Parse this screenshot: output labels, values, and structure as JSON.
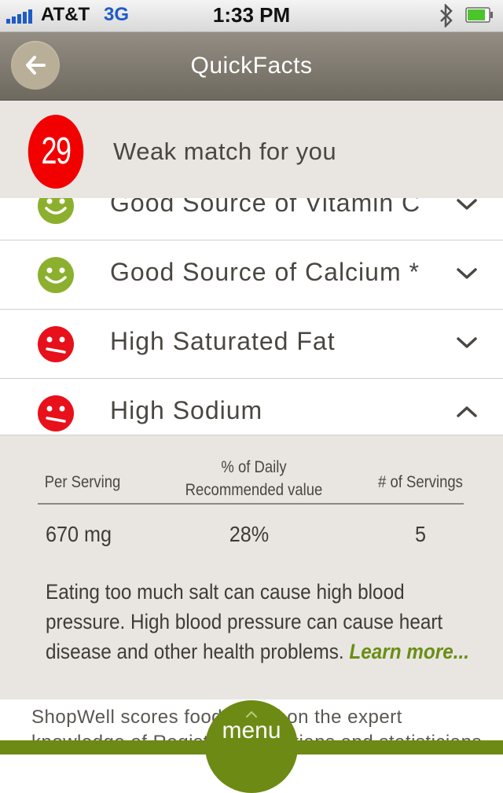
{
  "status_bar": {
    "carrier": "AT&T",
    "network": "3G",
    "time": "1:33 PM"
  },
  "header": {
    "title": "QuickFacts",
    "back_icon": "back-arrow-icon"
  },
  "score": {
    "value": "29",
    "text": "Weak match for you",
    "color": "#f20000"
  },
  "facts": [
    {
      "label": "Good Source of Vitamin C",
      "status": "good",
      "expanded": false
    },
    {
      "label": "Good Source of Calcium *",
      "status": "good",
      "expanded": false
    },
    {
      "label": "High Saturated Fat",
      "status": "bad",
      "expanded": false
    },
    {
      "label": "High Sodium",
      "status": "bad",
      "expanded": true
    }
  ],
  "detail": {
    "headers": {
      "per_serving": "Per Serving",
      "pct_line1": "% of Daily",
      "pct_line2": "Recommended value",
      "servings": "# of Servings"
    },
    "values": {
      "per_serving": "670 mg",
      "pct": "28%",
      "servings": "5"
    },
    "description": "Eating too much salt can cause high blood pressure. High blood pressure can cause heart disease and other health problems.",
    "learn_more": "Learn more..."
  },
  "footer": {
    "text_line1": "ShopWell scores food based on the expert",
    "text_line2": "knowledge of Registered Dietitians and statisticians"
  },
  "menu": {
    "label": "menu"
  },
  "colors": {
    "good": "#8cb02e",
    "bad": "#e8101a",
    "accent": "#6d8a14"
  }
}
